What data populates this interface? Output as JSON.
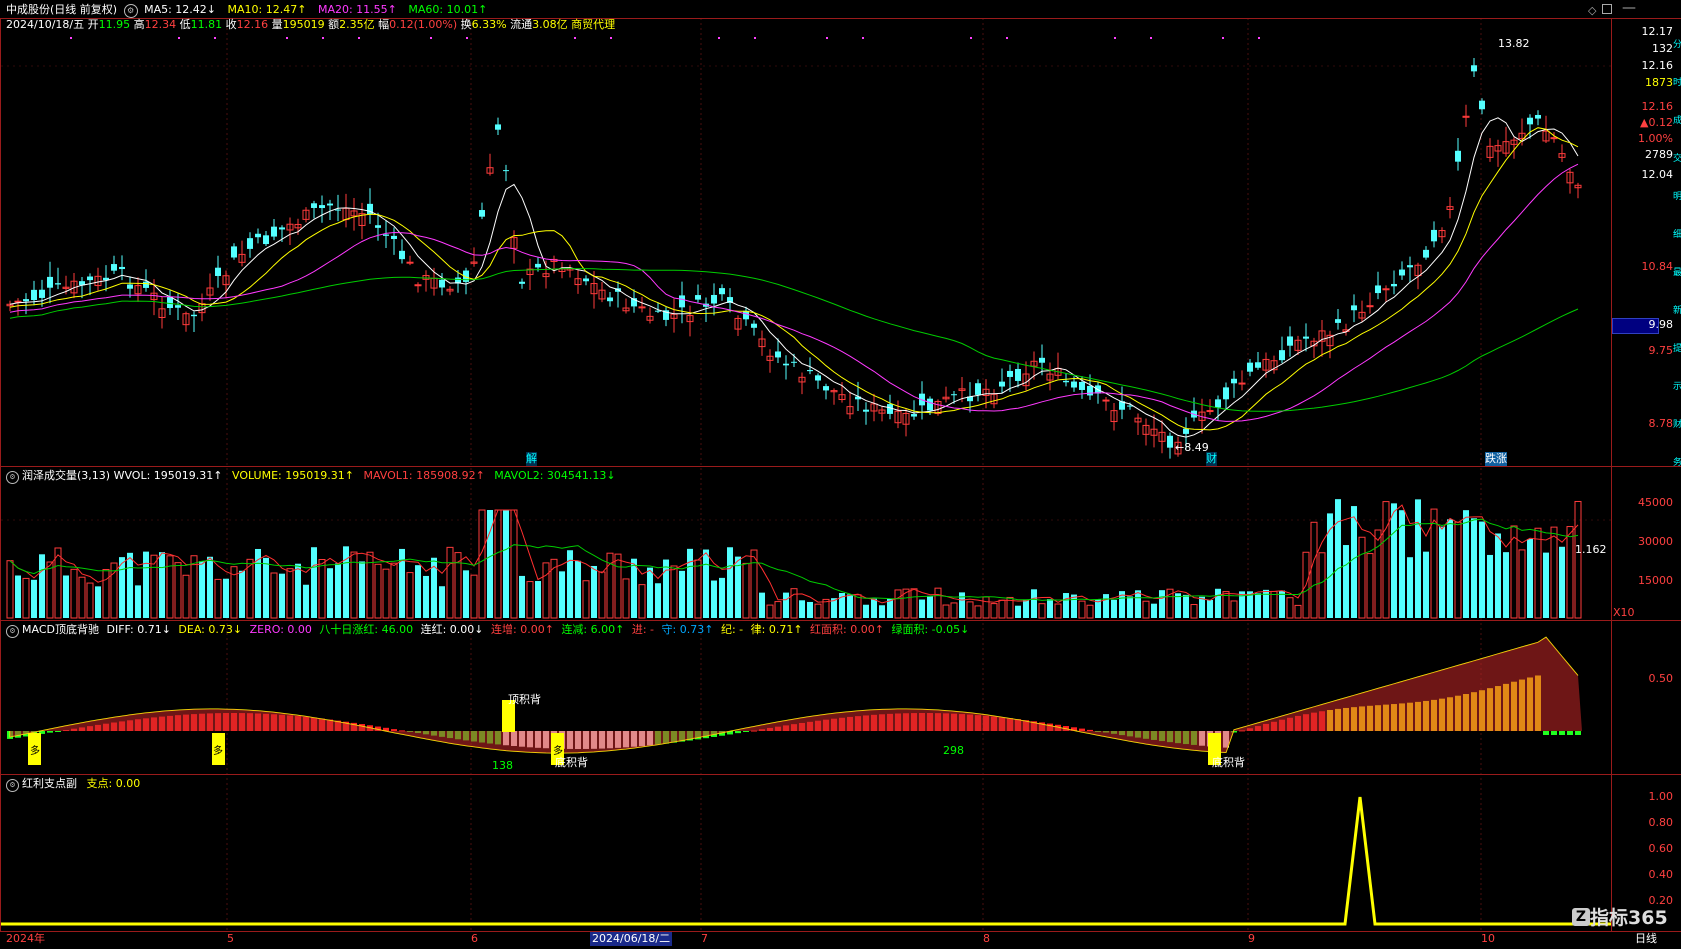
{
  "header": {
    "stock_name": "中成股份",
    "period_mode": "(日线 前复权)",
    "date": "2024/10/18/五",
    "open_label": "开",
    "open": "11.95",
    "high_label": "高",
    "high": "12.34",
    "low_label": "低",
    "low": "11.81",
    "close_label": "收",
    "close": "12.16",
    "volume_label": "量",
    "volume": "195019",
    "amount_label": "额",
    "amount": "2.35亿",
    "change_label": "幅",
    "change": "0.12(1.00%)",
    "turnover_label": "换",
    "turnover": "6.33%",
    "float_label": "流通",
    "float_cap": "3.08亿",
    "industry": "商贸代理",
    "ma5": "MA5: 12.42↓",
    "ma10": "MA10: 12.47↑",
    "ma20": "MA20: 11.55↑",
    "ma60": "MA60: 10.01↑"
  },
  "panels": {
    "volume": {
      "title": "润泽成交量(3,13)",
      "wvol": "WVOL: 195019.31↑",
      "volume": "VOLUME: 195019.31↑",
      "mavol1": "MAVOL1: 185908.92↑",
      "mavol2": "MAVOL2: 304541.13↓"
    },
    "macd": {
      "title": "MACD顶底背驰",
      "diff": "DIFF: 0.71↓",
      "dea": "DEA: 0.73↓",
      "zero": "ZERO: 0.00",
      "bashi": "八十日涨红: 46.00",
      "lianhong": "连红: 0.00↓",
      "lianzeng": "连增: 0.00↑",
      "lianjian": "连减: 6.00↑",
      "jin": "进: -",
      "shou": "守: 0.73↑",
      "ji": "纪: -",
      "lv": "律: 0.71↑",
      "hongmianji": "红面积: 0.00↑",
      "lvmianji": "绿面积: -0.05↓"
    },
    "hongli": {
      "title": "红利支点副",
      "zhidian": "支点: 0.00"
    }
  },
  "price_axis": {
    "labels": [
      "12.17",
      "132",
      "12.16",
      "1873",
      "12.16",
      "▲0.12",
      "1.00%",
      "2789",
      "12.04",
      "10.84",
      "9.98",
      "9.75",
      "8.78"
    ],
    "colors": [
      "#ffffff",
      "#ffffff",
      "#ffffff",
      "#ffff00",
      "#ff4040",
      "#ff4040",
      "#ff4040",
      "#ffffff",
      "#ffffff",
      "#ff4040",
      "#ffffff",
      "#ff4040",
      "#ff4040"
    ]
  },
  "volume_axis": {
    "labels": [
      "45000",
      "30000",
      "15000",
      "X10"
    ]
  },
  "macd_axis": {
    "labels": [
      "0.50"
    ]
  },
  "hongli_axis": {
    "labels": [
      "1.00",
      "0.80",
      "0.60",
      "0.40",
      "0.20"
    ]
  },
  "date_axis": {
    "labels": [
      "2024年",
      "5",
      "6",
      "7",
      "8",
      "9",
      "10"
    ],
    "cursor_date": "2024/06/18/二"
  },
  "annotations": {
    "high": "13.82",
    "low": "←8.49",
    "vol_value": "1.162",
    "macd_138": "138",
    "macd_298": "298",
    "top_div": "顶积背",
    "bottom_div": "底积背",
    "duo": "多",
    "jie": "解",
    "cai": "财",
    "diezhang": "跌涨"
  },
  "footer": {
    "brand": "指标365",
    "period": "日线"
  },
  "right_tabs": [
    "分",
    "时",
    "成",
    "交",
    "明",
    "细",
    "最",
    "新",
    "提",
    "示",
    "财",
    "务"
  ],
  "colors": {
    "up": "#ff3b3b",
    "down": "#54ffff",
    "ma5": "#ffffff",
    "ma10": "#ffff00",
    "ma20": "#ff3aff",
    "ma60": "#00cc00",
    "grid": "#9a1b1b",
    "macd_fill_red": "#c82828",
    "macd_fill_green": "#2d8a3c"
  },
  "icons": [
    "settings-diamond-icon",
    "restore-icon",
    "close-icon"
  ]
}
